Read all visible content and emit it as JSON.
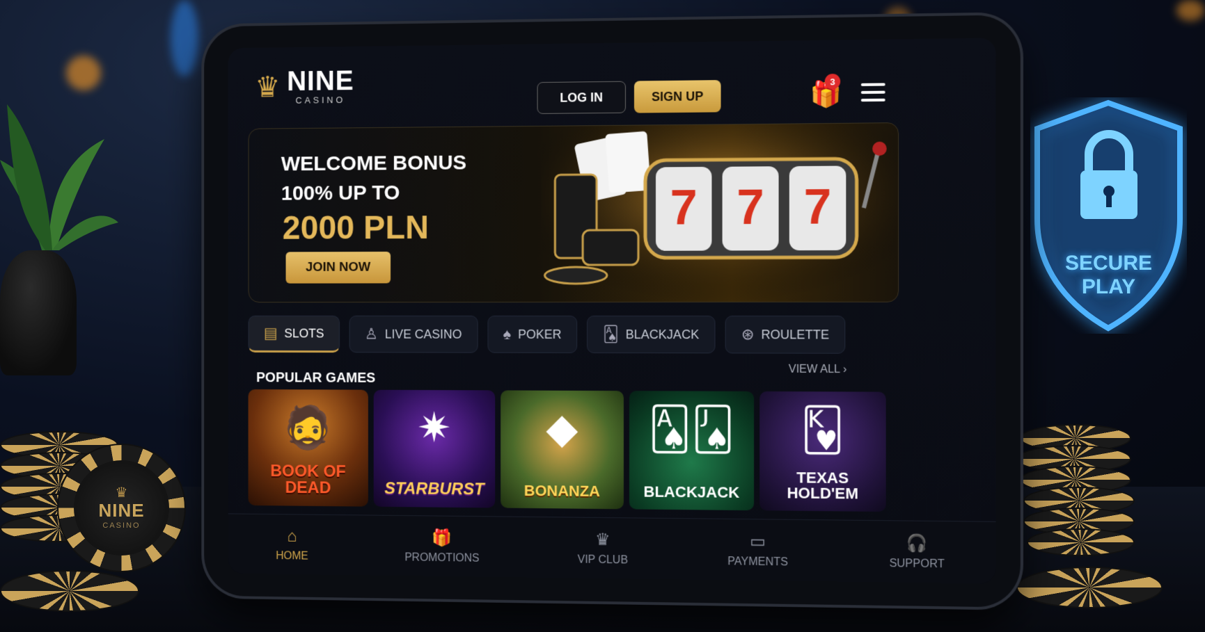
{
  "brand": {
    "name": "NINE",
    "sub": "CASINO"
  },
  "header": {
    "login_label": "LOG IN",
    "signup_label": "SIGN UP",
    "gift_count": "3"
  },
  "hero": {
    "line1": "WELCOME BONUS",
    "line2": "100% UP TO",
    "amount": "2000 PLN",
    "cta_label": "JOIN NOW"
  },
  "categories": [
    {
      "label": "SLOTS",
      "icon": "slot-machine-icon",
      "active": true
    },
    {
      "label": "LIVE CASINO",
      "icon": "dealer-icon",
      "active": false
    },
    {
      "label": "POKER",
      "icon": "spade-icon",
      "active": false
    },
    {
      "label": "BLACKJACK",
      "icon": "cards-icon",
      "active": false
    },
    {
      "label": "ROULETTE",
      "icon": "roulette-icon",
      "active": false
    }
  ],
  "popular": {
    "title": "POPULAR GAMES",
    "view_all_label": "VIEW ALL",
    "games": [
      {
        "label": "BOOK OF DEAD"
      },
      {
        "label": "STARBURST"
      },
      {
        "label": "BONANZA"
      },
      {
        "label": "BLACKJACK"
      },
      {
        "label": "TEXAS HOLD'EM"
      }
    ]
  },
  "bottom_nav": [
    {
      "label": "HOME",
      "icon": "home-icon",
      "active": true
    },
    {
      "label": "PROMOTIONS",
      "icon": "gift-icon",
      "active": false
    },
    {
      "label": "VIP CLUB",
      "icon": "crown-icon",
      "active": false
    },
    {
      "label": "PAYMENTS",
      "icon": "wallet-icon",
      "active": false
    },
    {
      "label": "SUPPORT",
      "icon": "headset-icon",
      "active": false
    }
  ],
  "shield": {
    "line1": "SECURE",
    "line2": "PLAY"
  },
  "chip": {
    "name": "NINE",
    "sub": "CASINO"
  },
  "colors": {
    "gold": "#d4a84c",
    "accent_blue": "#39a5ff",
    "badge_red": "#e02b2b"
  }
}
